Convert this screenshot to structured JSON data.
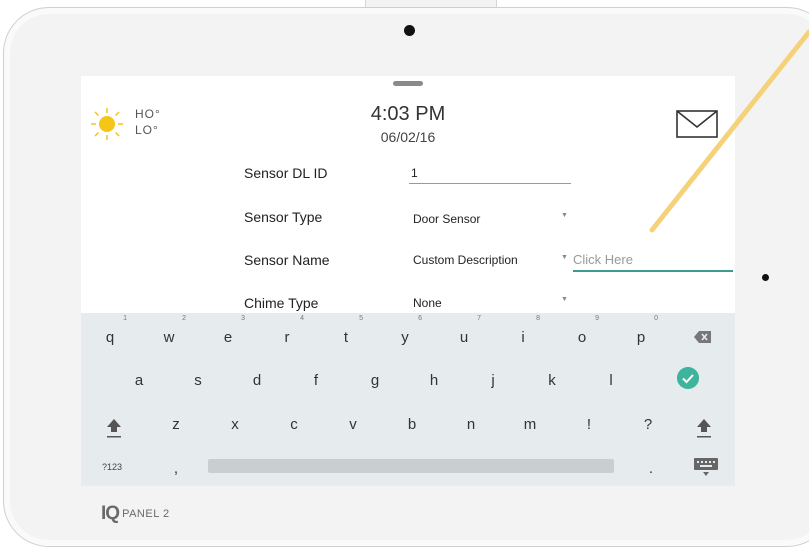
{
  "weather": {
    "icon": "sun-icon",
    "high": "HO°",
    "low": "LO°",
    "sun_color": "#f5c518"
  },
  "clock": {
    "time": "4:03 PM",
    "date": "06/02/16"
  },
  "header": {
    "message_icon": "mail-icon"
  },
  "form": {
    "dl_id": {
      "label": "Sensor DL ID",
      "value": "1"
    },
    "sensor_type": {
      "label": "Sensor Type",
      "value": "Door Sensor"
    },
    "sensor_name": {
      "label": "Sensor Name",
      "value": "Custom Description",
      "custom_placeholder": "Click Here"
    },
    "chime_type": {
      "label": "Chime Type",
      "value": "None"
    }
  },
  "keyboard": {
    "row1": [
      "q",
      "w",
      "e",
      "r",
      "t",
      "y",
      "u",
      "i",
      "o",
      "p"
    ],
    "row1_hints": [
      "1",
      "2",
      "3",
      "4",
      "5",
      "6",
      "7",
      "8",
      "9",
      "0"
    ],
    "row2": [
      "a",
      "s",
      "d",
      "f",
      "g",
      "h",
      "j",
      "k",
      "l"
    ],
    "row3": [
      "z",
      "x",
      "c",
      "v",
      "b",
      "n",
      "m",
      "!",
      "?"
    ],
    "symbols_key": "?123",
    "comma_key": ",",
    "period_key": ".",
    "accent_color": "#3fb49c"
  },
  "brand": {
    "iq": "IQ",
    "panel": "PANEL 2"
  }
}
